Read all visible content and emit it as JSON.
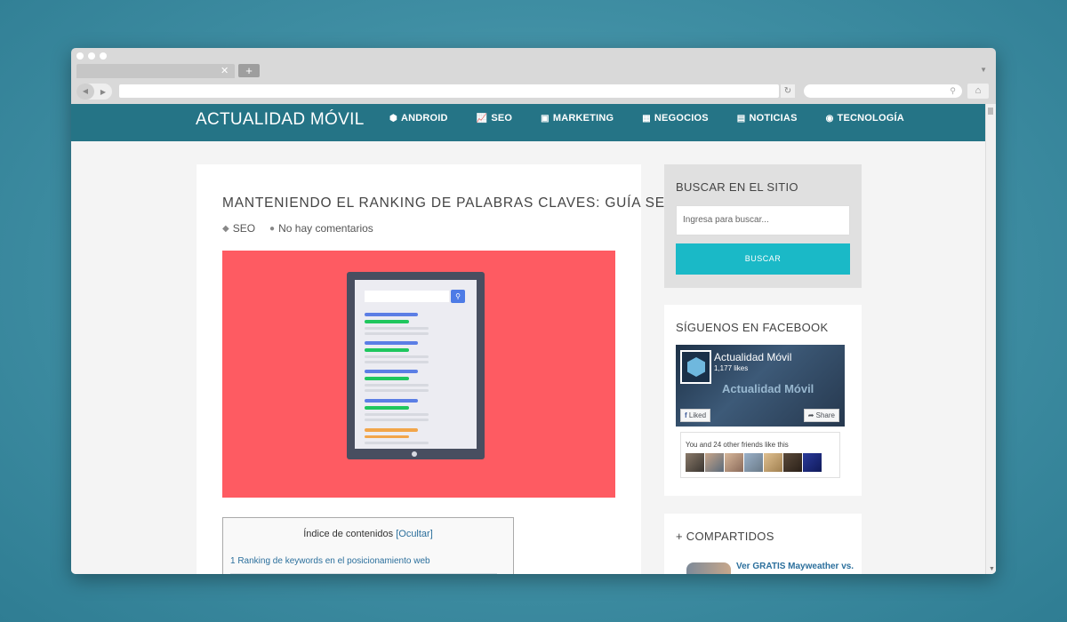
{
  "site": {
    "brand": "ACTUALIDAD MÓVIL",
    "nav": [
      {
        "label": "ANDROID",
        "icon": "android-icon"
      },
      {
        "label": "SEO",
        "icon": "chart-icon"
      },
      {
        "label": "MARKETING",
        "icon": "money-icon"
      },
      {
        "label": "NEGOCIOS",
        "icon": "calculator-icon"
      },
      {
        "label": "NOTICIAS",
        "icon": "newspaper-icon"
      },
      {
        "label": "TECNOLOGÍA",
        "icon": "rss-icon"
      }
    ]
  },
  "post": {
    "title": "MANTENIENDO EL RANKING DE PALABRAS CLAVES: GUÍA SEO",
    "category": "SEO",
    "comments": "No hay comentarios"
  },
  "toc": {
    "title": "Índice de contenidos",
    "toggle": "[Ocultar]",
    "items": [
      "1 Ranking de keywords en el posicionamiento web"
    ]
  },
  "sidebar": {
    "search": {
      "title": "BUSCAR EN EL SITIO",
      "placeholder": "Ingresa para buscar...",
      "button": "BUSCAR"
    },
    "facebook": {
      "title": "SÍGUENOS EN FACEBOOK",
      "page_name": "Actualidad Móvil",
      "likes": "1,177 likes",
      "watermark": "Actualidad Móvil",
      "liked_label": "Liked",
      "share_label": "Share",
      "friends_text": "You and 24 other friends like this"
    },
    "shared": {
      "title": "+ COMPARTIDOS",
      "items": [
        "Ver GRATIS Mayweather vs."
      ]
    }
  },
  "colors": {
    "header": "#257486",
    "hero_bg": "#fe5b62",
    "button": "#1ab9c7",
    "link": "#2b6f9c"
  }
}
